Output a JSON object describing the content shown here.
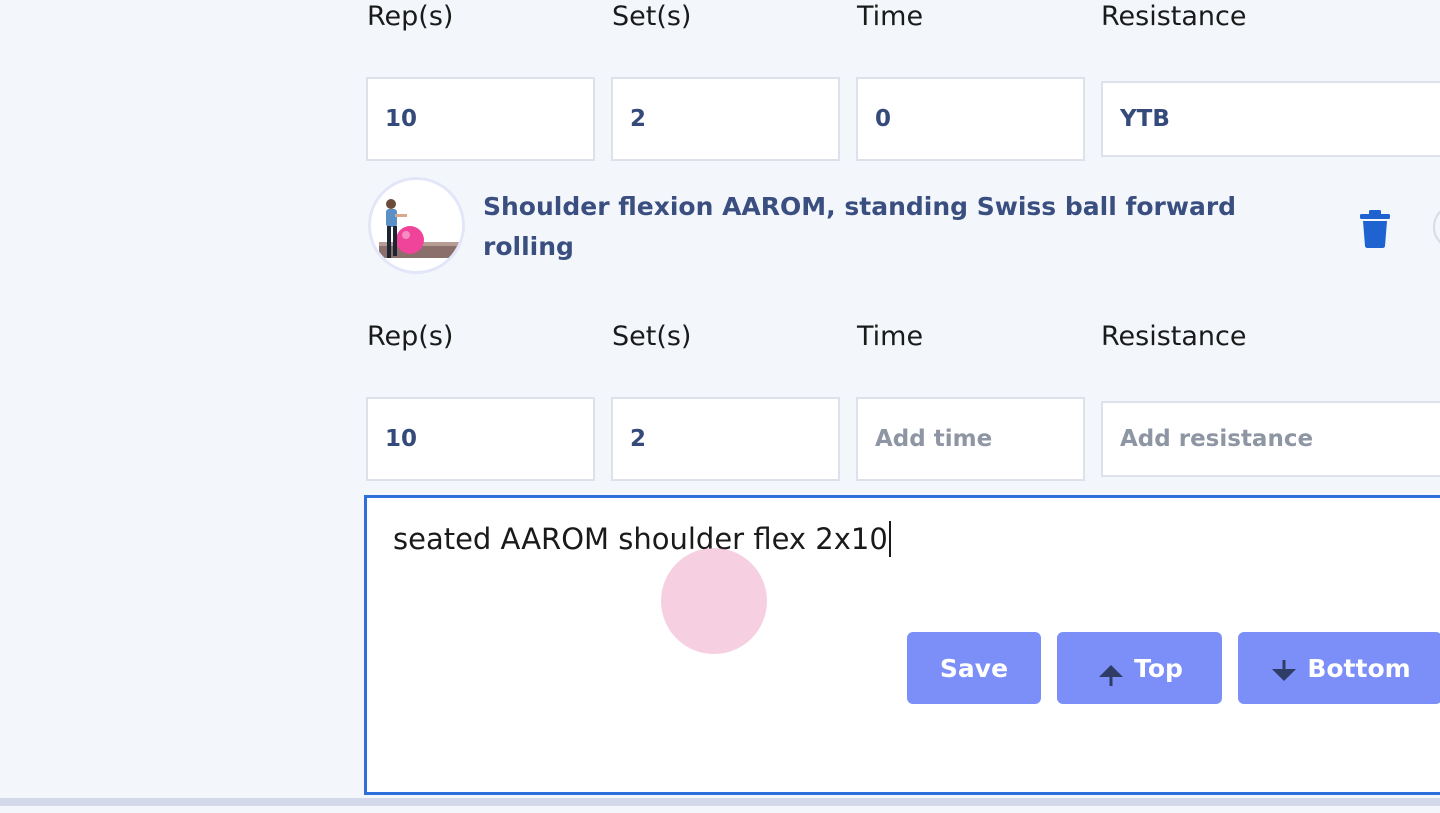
{
  "row1": {
    "labels": {
      "reps": "Rep(s)",
      "sets": "Set(s)",
      "time": "Time",
      "resistance": "Resistance"
    },
    "values": {
      "reps": "10",
      "sets": "2",
      "time": "0",
      "resistance": "YTB"
    }
  },
  "exercise": {
    "title": "Shoulder flexion AAROM, standing Swiss ball forward rolling",
    "thumbnail_icon": "exercise-thumbnail",
    "delete_icon": "trash-icon"
  },
  "row2": {
    "labels": {
      "reps": "Rep(s)",
      "sets": "Set(s)",
      "time": "Time",
      "resistance": "Resistance"
    },
    "values": {
      "reps": "10",
      "sets": "2",
      "time": "",
      "resistance": ""
    },
    "placeholders": {
      "time": "Add time",
      "resistance": "Add resistance"
    }
  },
  "notes": {
    "value": "seated AAROM shoulder flex 2x10"
  },
  "actions": {
    "save": "Save",
    "top": "Top",
    "bottom": "Bottom"
  },
  "colors": {
    "accent_button": "#7c8ef7",
    "focus_border": "#2f6fdc",
    "trash": "#1e63d0",
    "title_text": "#3a4f80"
  }
}
